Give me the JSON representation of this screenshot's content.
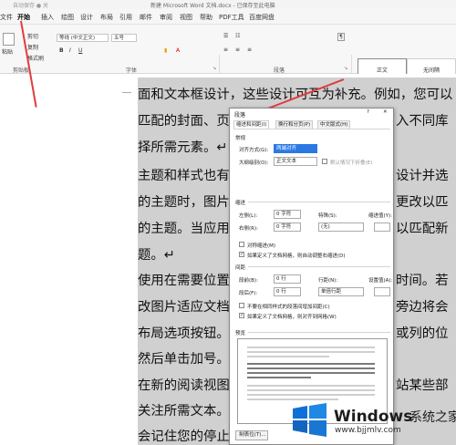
{
  "titlebar": {
    "quick_access": "自动保存 ● 关",
    "title": "新建 Microsoft Word 文档.docx - 已保存至此电脑"
  },
  "menu": {
    "items": [
      "文件",
      "开始",
      "插入",
      "绘图",
      "设计",
      "布局",
      "引用",
      "邮件",
      "审阅",
      "视图",
      "帮助",
      "PDF工具",
      "百度网盘"
    ],
    "active": "开始"
  },
  "ribbon": {
    "paste_label": "粘贴",
    "cut_label": "剪切",
    "copy_label": "复制",
    "format_painter_label": "格式刷",
    "clipboard_group": "剪贴板",
    "font_name": "等线 (中文正文)",
    "font_size": "五号",
    "font_group": "字体",
    "paragraph_group": "段落",
    "style_normal": "正文",
    "style_no_spacing": "无间隔"
  },
  "document": {
    "lines": [
      "面和文本框设计，这些设计可互为补充。例如，您可以",
      "匹配的封面、页",
      "择所需元素。↵",
      "主题和样式也有",
      "的主题时，图片",
      "的主题。当应用",
      "题。↵",
      "使用在需要位置",
      "改图片适应文档",
      "布局选项按钮。",
      "然后单击加号。",
      "在新的阅读视图",
      "关注所需文本。",
      "会记住您的停止"
    ],
    "right_fragments": [
      "入不同库",
      "设计并选",
      "更改以匹",
      "以匹配新",
      "时间。若",
      "旁边将会",
      "或列的位",
      "站某些部"
    ]
  },
  "dialog": {
    "title": "段落",
    "help": "?",
    "close": "✕",
    "tabs": [
      "缩进和间距(I)",
      "换行和分页(P)",
      "中文版式(H)"
    ],
    "general": {
      "heading": "常规",
      "alignment_label": "对齐方式(G):",
      "alignment_value": "两端对齐",
      "outline_label": "大纲级别(O):",
      "outline_value": "正文文本",
      "collapsed_label": "默认情况下折叠(E)"
    },
    "indent": {
      "heading": "缩进",
      "left_label": "左侧(L):",
      "left_value": "0 字符",
      "right_label": "右侧(R):",
      "right_value": "0 字符",
      "special_label": "特殊(S):",
      "special_value": "(无)",
      "by_label": "缩进值(Y):",
      "by_value": "",
      "mirror_label": "对称缩进(M)",
      "auto_adjust_label": "如果定义了文档网格，则自动调整右缩进(D)"
    },
    "spacing": {
      "heading": "间距",
      "before_label": "段前(B):",
      "before_value": "0 行",
      "after_label": "段后(F):",
      "after_value": "0 行",
      "line_label": "行距(N):",
      "line_value": "单倍行距",
      "at_label": "设置值(A):",
      "at_value": "",
      "no_space_label": "不要在相同样式的段落间增加间距(C)",
      "snap_grid_label": "如果定义了文档网格，则对齐到网格(W)"
    },
    "preview_heading": "预览",
    "tabs_button": "制表位(T)..."
  },
  "watermark": {
    "brand": "Windows",
    "sub": "系统之家",
    "url": "www.bjjmlv.com"
  },
  "colors": {
    "arrow": "#e23b3b",
    "selection": "#d0d0d0",
    "accent": "#2b78e4"
  }
}
